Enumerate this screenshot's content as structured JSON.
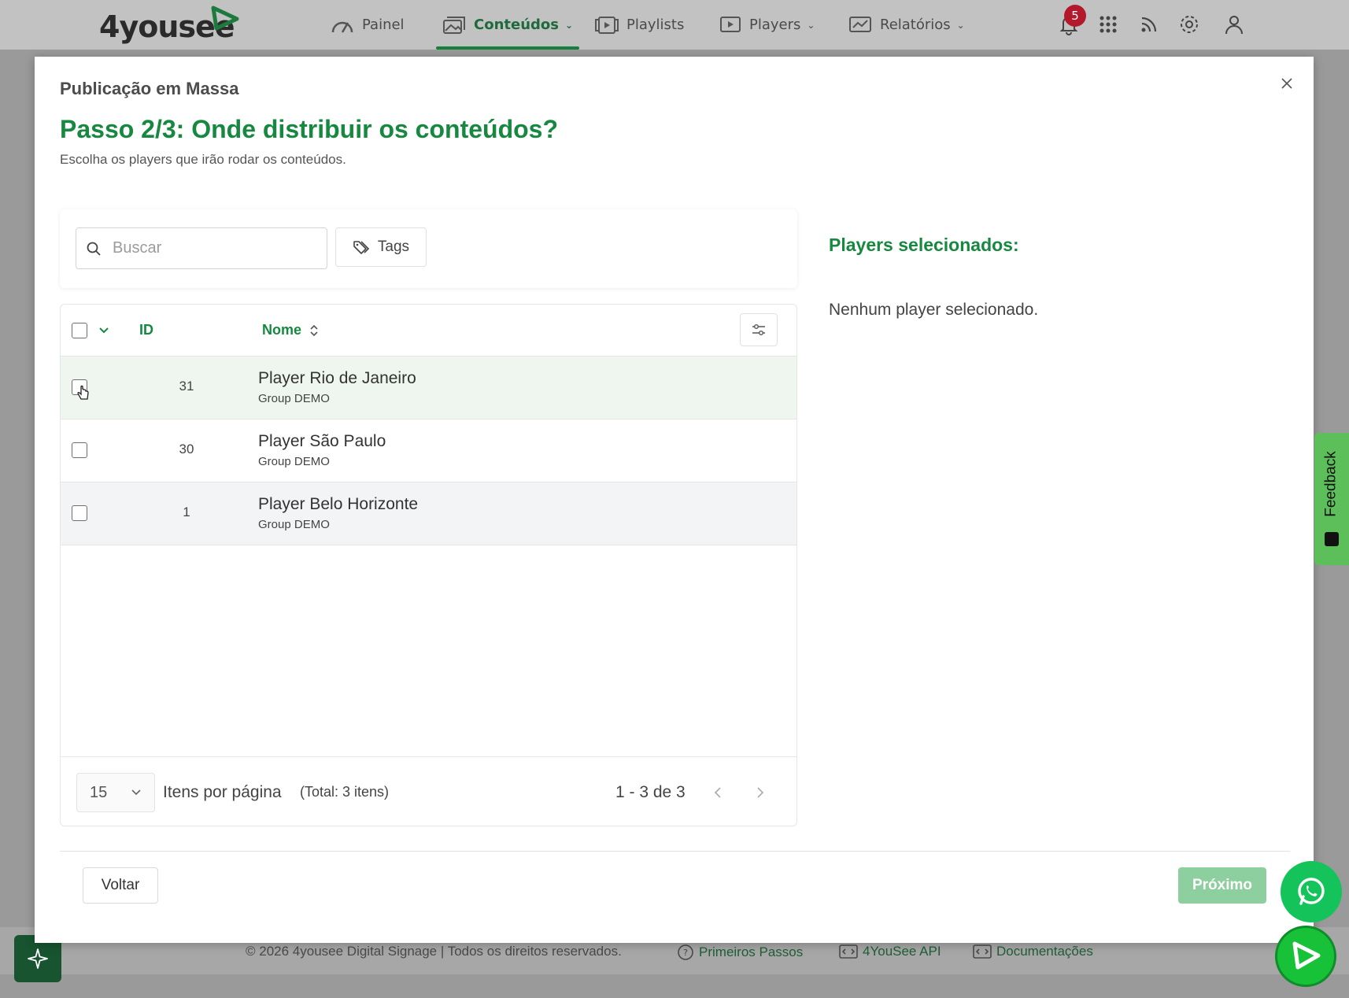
{
  "app": {
    "brand": "4yousee",
    "nav": [
      {
        "label": "Painel",
        "icon": "gauge-icon"
      },
      {
        "label": "Conteúdos",
        "icon": "image-stack-icon",
        "active": true
      },
      {
        "label": "Playlists",
        "icon": "playlist-icon"
      },
      {
        "label": "Players",
        "icon": "player-icon"
      },
      {
        "label": "Relatórios",
        "icon": "chart-icon"
      }
    ],
    "notifications_count": "5"
  },
  "modal": {
    "title": "Publicação em Massa",
    "step_title": "Passo 2/3: Onde distribuir os conteúdos?",
    "step_subtitle": "Escolha os players que irão rodar os conteúdos.",
    "search_placeholder": "Buscar",
    "tags_label": "Tags",
    "table": {
      "columns": {
        "id": "ID",
        "name": "Nome"
      },
      "rows": [
        {
          "id": "31",
          "name": "Player Rio de Janeiro",
          "group": "Group DEMO"
        },
        {
          "id": "30",
          "name": "Player São Paulo",
          "group": "Group DEMO"
        },
        {
          "id": "1",
          "name": "Player Belo Horizonte",
          "group": "Group DEMO"
        }
      ],
      "per_page": "15",
      "per_page_label": "Itens por página",
      "total_label": "(Total: 3 itens)",
      "range_label": "1 - 3 de 3"
    },
    "selected_title": "Players selecionados:",
    "selected_empty": "Nenhum player selecionado.",
    "back_label": "Voltar",
    "next_label": "Próximo"
  },
  "footer": {
    "copyright": "© 2026 4yousee Digital Signage | Todos os direitos reservados.",
    "links": [
      "Primeiros Passos",
      "4YouSee API",
      "Documentações"
    ]
  },
  "feedback_label": "Feedback",
  "colors": {
    "brand_green": "#16883f",
    "next_disabled": "#8dcf9e",
    "badge_red": "#b3192b",
    "feedback_green": "#5cbf5a",
    "whatsapp_green": "#14c45a"
  }
}
